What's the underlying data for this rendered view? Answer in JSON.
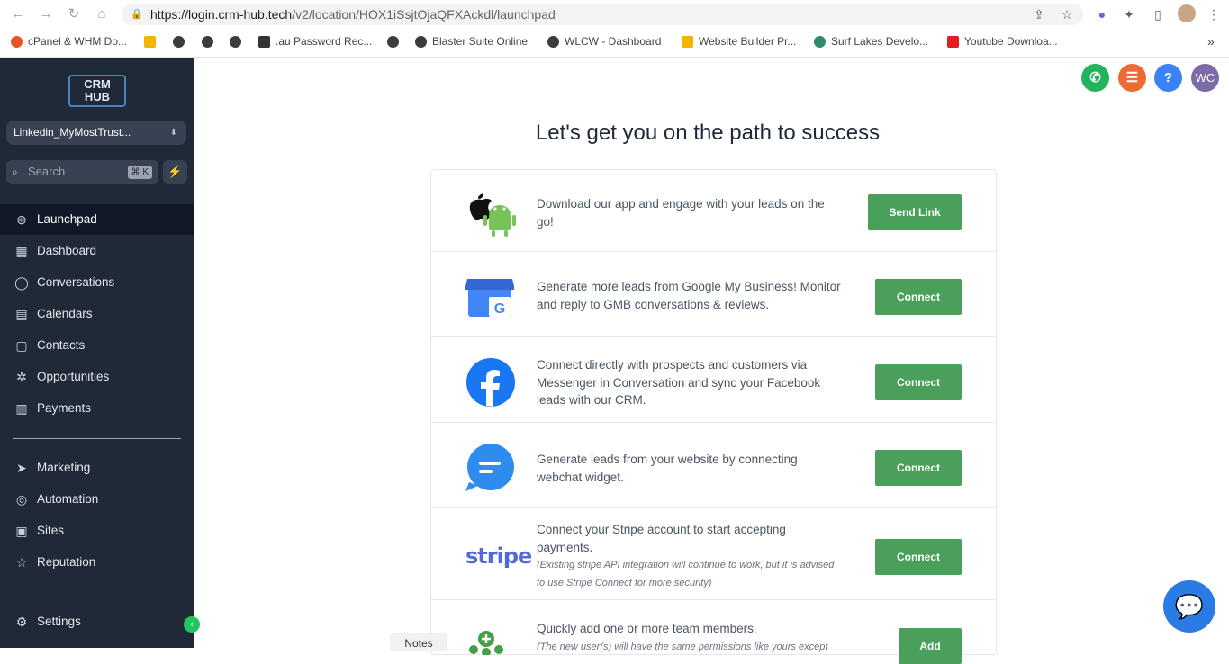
{
  "browser": {
    "url_host": "https://login.crm-hub.tech",
    "url_path": "/v2/location/HOX1iSsjtOjaQFXAckdl/launchpad",
    "bookmarks": [
      "cPanel & WHM Do...",
      ".au Password Rec...",
      "Blaster Suite Online",
      "WLCW - Dashboard",
      "Website Builder Pr...",
      "Surf Lakes Develo...",
      "Youtube Downloa..."
    ],
    "more_bookmarks": "»"
  },
  "sidebar": {
    "logo": "CRM HUB",
    "account": "Linkedin_MyMostTrust...",
    "search_placeholder": "Search",
    "search_shortcut": "⌘ K",
    "items": [
      {
        "label": "Launchpad",
        "icon": "rocket-icon",
        "active": true
      },
      {
        "label": "Dashboard",
        "icon": "dashboard-icon"
      },
      {
        "label": "Conversations",
        "icon": "chat-icon"
      },
      {
        "label": "Calendars",
        "icon": "calendar-icon"
      },
      {
        "label": "Contacts",
        "icon": "contacts-icon"
      },
      {
        "label": "Opportunities",
        "icon": "opportunities-icon"
      },
      {
        "label": "Payments",
        "icon": "payments-icon"
      },
      {
        "label": "Marketing",
        "icon": "send-icon"
      },
      {
        "label": "Automation",
        "icon": "automation-icon"
      },
      {
        "label": "Sites",
        "icon": "sites-icon"
      },
      {
        "label": "Reputation",
        "icon": "star-icon"
      },
      {
        "label": "Settings",
        "icon": "gear-icon"
      }
    ]
  },
  "topbar": {
    "avatar_initials": "WC",
    "help": "?"
  },
  "main": {
    "headline": "Let's get you on the path to success",
    "rows": [
      {
        "text": "Download our app and engage with your leads on the go!",
        "button": "Send Link"
      },
      {
        "text": "Generate more leads from Google My Business! Monitor and reply to GMB conversations & reviews.",
        "button": "Connect"
      },
      {
        "text": "Connect directly with prospects and customers via Messenger in Conversation and sync your Facebook leads with our CRM.",
        "button": "Connect"
      },
      {
        "text": "Generate leads from your website by connecting webchat widget.",
        "button": "Connect"
      },
      {
        "text": "Connect your Stripe account to start accepting payments.",
        "note": "(Existing stripe API integration will continue to work, but it is advised to use Stripe Connect for more security)",
        "button": "Connect",
        "logo_text": "stripe"
      },
      {
        "text": "Quickly add one or more team members.",
        "note": "(The new user(s) will have the same permissions like yours except",
        "button": "Add"
      }
    ]
  },
  "notes_label": "Notes",
  "colors": {
    "sidebar": "#1f2937",
    "accent_green": "#4aa05a",
    "chat": "#2b7be4"
  }
}
